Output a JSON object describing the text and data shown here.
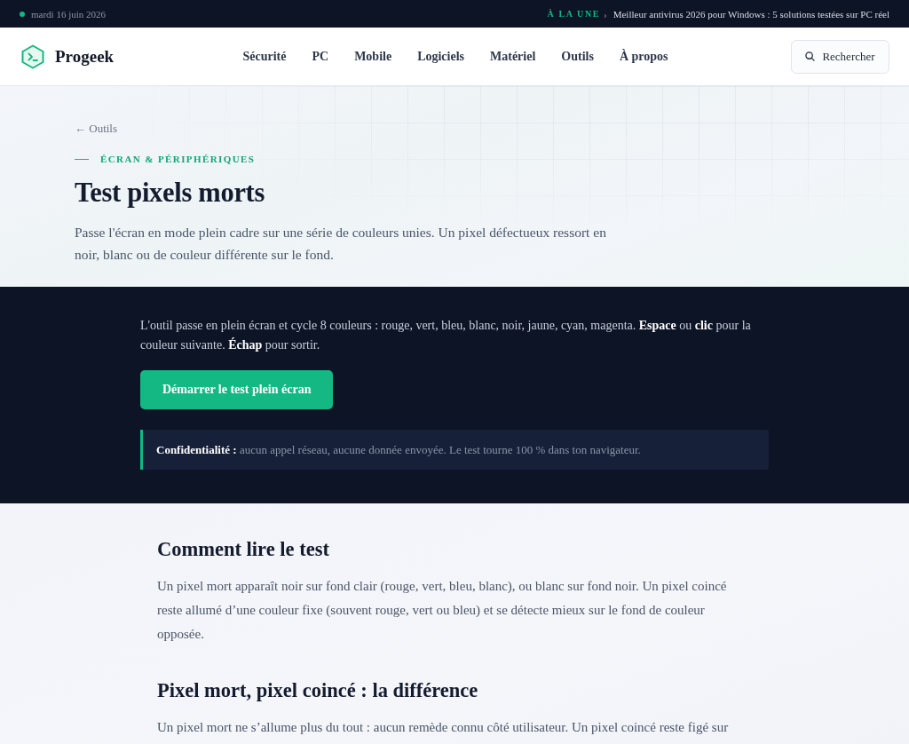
{
  "top_bar": {
    "date": "mardi 16 juin 2026",
    "headline_label": "À LA UNE",
    "headline_arrow": "›",
    "headline": "Meilleur antivirus 2026 pour Windows : 5 solutions testées sur PC réel"
  },
  "header": {
    "logo": "Progeek",
    "nav": [
      {
        "label": "Sécurité"
      },
      {
        "label": "PC"
      },
      {
        "label": "Mobile"
      },
      {
        "label": "Logiciels"
      },
      {
        "label": "Matériel"
      },
      {
        "label": "Outils"
      },
      {
        "label": "À propos"
      }
    ],
    "search_button": "Rechercher"
  },
  "hero": {
    "back_link": "← Outils",
    "kicker": "ÉCRAN & PÉRIPHÉRIQUES",
    "title": "Test pixels morts",
    "intro": "Passe l'écran en mode plein cadre sur une série de couleurs unies. Un pixel défectueux ressort en noir, blanc ou de couleur différente sur le fond."
  },
  "tool": {
    "instructions": "L'outil passe en plein écran et cycle 8 couleurs : rouge, vert, bleu, blanc, noir, jaune, cyan, magenta. **Espace** ou **clic** pour la couleur suivante. **Échap** pour sortir.",
    "start_button": "Démarrer le test plein écran",
    "privacy_note": "**Confidentialité :** aucun appel réseau, aucune donnée envoyée. Le test tourne 100 % dans ton navigateur."
  },
  "sections": [
    {
      "heading": "Comment lire le test",
      "body": "Un pixel mort apparaît noir sur fond clair (rouge, vert, bleu, blanc), ou blanc sur fond noir. Un pixel coincé reste allumé d’une couleur fixe (souvent rouge, vert ou bleu) et se détecte mieux sur le fond de couleur opposée."
    },
    {
      "heading": "Pixel mort, pixel coincé : la différence",
      "body": "Un pixel mort ne s’allume plus du tout : aucun remède connu côté utilisateur. Un pixel coincé reste figé sur"
    }
  ]
}
